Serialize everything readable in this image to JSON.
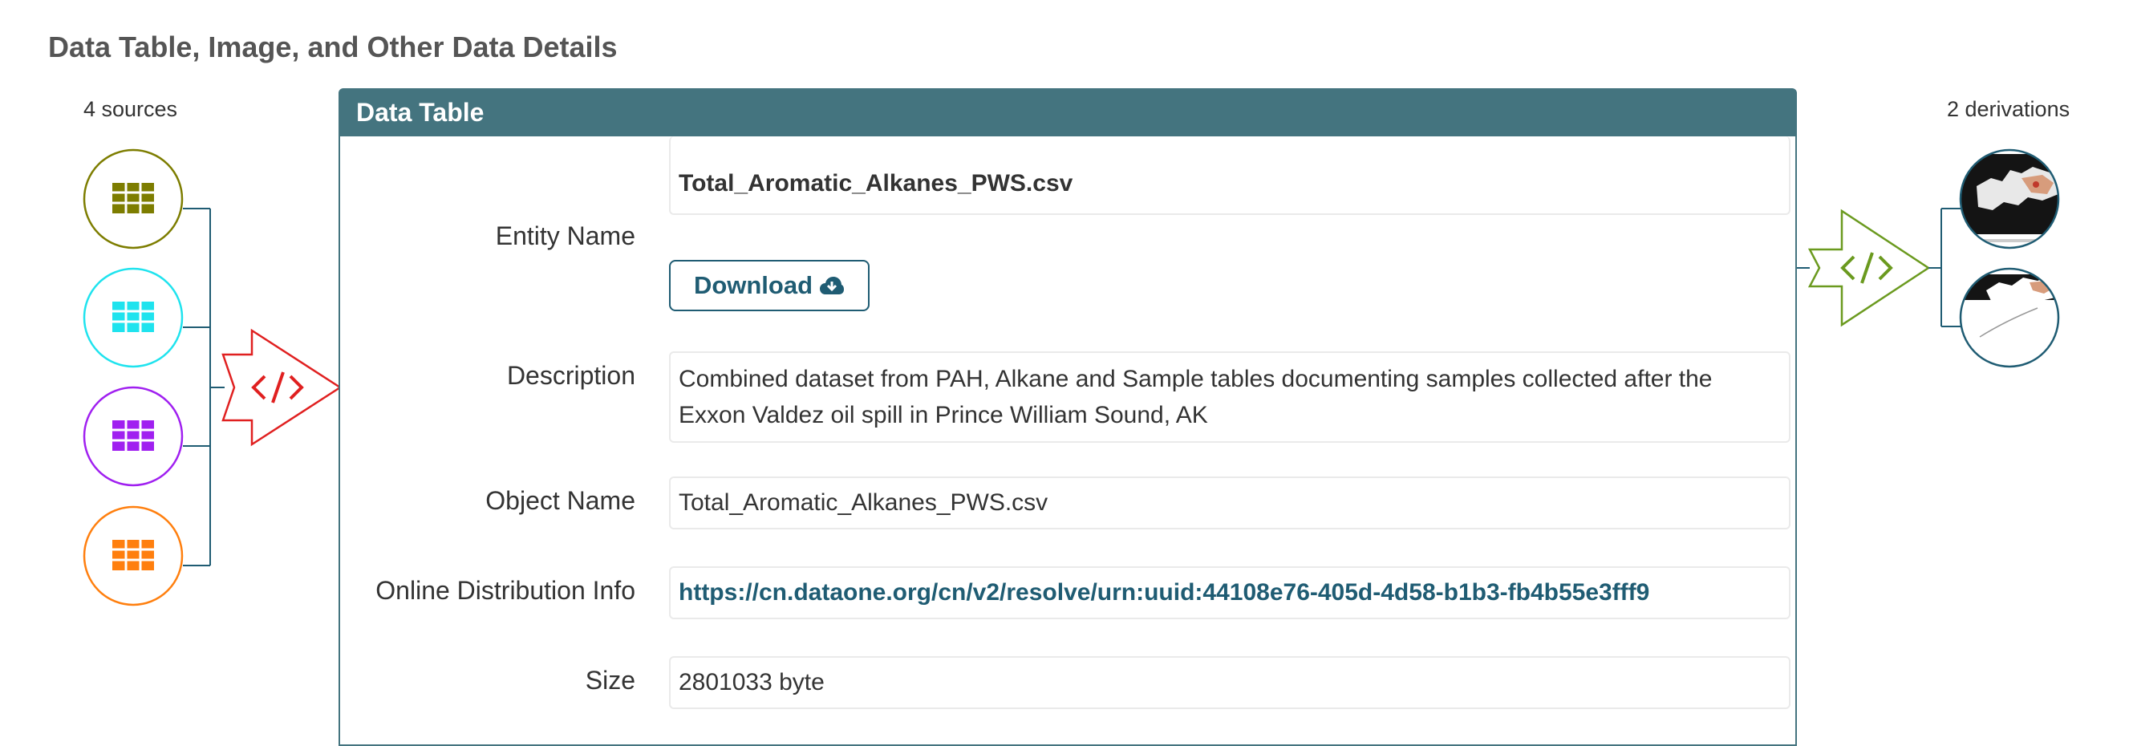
{
  "page": {
    "title": "Data Table, Image, and Other Data Details"
  },
  "provenance": {
    "sources_label": "4 sources",
    "derivations_label": "2 derivations",
    "sources": [
      {
        "icon": "table-icon",
        "color": "#7d7d00"
      },
      {
        "icon": "table-icon",
        "color": "#1fe3ee"
      },
      {
        "icon": "table-icon",
        "color": "#a020f0"
      },
      {
        "icon": "table-icon",
        "color": "#ff7f0e"
      }
    ],
    "input_program_color": "#e02020",
    "output_program_color": "#6b9a1f",
    "line_color": "#1f5c73"
  },
  "panel": {
    "title": "Data Table",
    "header_color": "#44747f",
    "download_label": "Download",
    "fields": {
      "entity_name": {
        "label": "Entity Name",
        "value": "Total_Aromatic_Alkanes_PWS.csv"
      },
      "description": {
        "label": "Description",
        "value": "Combined dataset from PAH, Alkane and Sample tables documenting samples collected after the Exxon Valdez oil spill in Prince William Sound, AK"
      },
      "object_name": {
        "label": "Object Name",
        "value": "Total_Aromatic_Alkanes_PWS.csv"
      },
      "online_distribution": {
        "label": "Online Distribution Info",
        "value": "https://cn.dataone.org/cn/v2/resolve/urn:uuid:44108e76-405d-4d58-b1b3-fb4b55e3fff9"
      },
      "size": {
        "label": "Size",
        "value": "2801033 byte"
      }
    }
  }
}
